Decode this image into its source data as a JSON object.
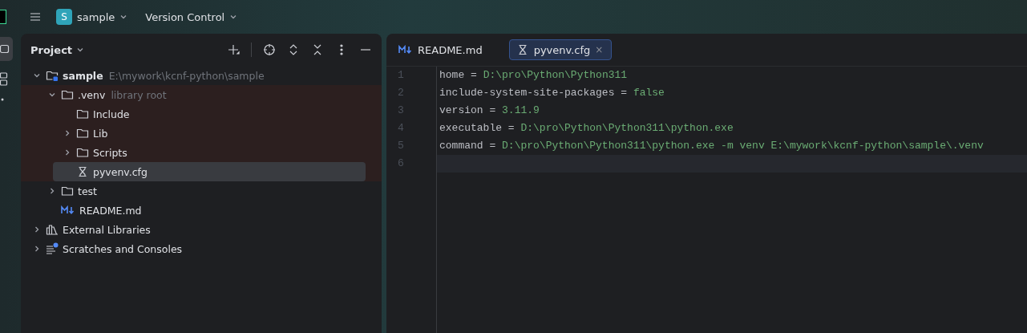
{
  "toolbar": {
    "project_badge": "S",
    "project_name": "sample",
    "vcs": "Version Control"
  },
  "project_panel": {
    "title": "Project",
    "tree": [
      {
        "name": "sample",
        "hint": "E:\\mywork\\kcnf-python\\sample",
        "kind": "module",
        "expanded": true,
        "selected": false,
        "tinted": false,
        "children": [
          {
            "name": ".venv",
            "hint": "library root",
            "kind": "folder",
            "expanded": true,
            "selected": false,
            "tinted": true,
            "children": [
              {
                "name": "Include",
                "kind": "folder",
                "selected": false,
                "tinted": true
              },
              {
                "name": "Lib",
                "kind": "folder",
                "expanded": false,
                "selected": false,
                "tinted": true
              },
              {
                "name": "Scripts",
                "kind": "folder",
                "expanded": false,
                "selected": false,
                "tinted": true
              },
              {
                "name": "pyvenv.cfg",
                "kind": "cfg",
                "selected": true,
                "tinted": true
              }
            ]
          },
          {
            "name": "test",
            "kind": "folder",
            "expanded": false,
            "selected": false,
            "tinted": false
          },
          {
            "name": "README.md",
            "kind": "md",
            "selected": false,
            "tinted": false
          }
        ]
      },
      {
        "name": "External Libraries",
        "kind": "libraries",
        "expanded": false,
        "selected": false,
        "tinted": false
      },
      {
        "name": "Scratches and Consoles",
        "kind": "scratches",
        "expanded": false,
        "selected": false,
        "tinted": false
      }
    ]
  },
  "editor": {
    "tabs": [
      {
        "label": "README.md",
        "kind": "md",
        "selected": false
      },
      {
        "label": "pyvenv.cfg",
        "kind": "cfg",
        "selected": true,
        "close": "×"
      }
    ],
    "lines": [
      {
        "number": "1",
        "key": "home",
        "op": "=",
        "value": "D:\\pro\\Python\\Python311",
        "current": false
      },
      {
        "number": "2",
        "key": "include-system-site-packages",
        "op": "=",
        "value": "false",
        "current": false
      },
      {
        "number": "3",
        "key": "version",
        "op": "=",
        "value": "3.11.9",
        "current": false
      },
      {
        "number": "4",
        "key": "executable",
        "op": "=",
        "value": "D:\\pro\\Python\\Python311\\python.exe",
        "current": false
      },
      {
        "number": "5",
        "key": "command",
        "op": "=",
        "value": "D:\\pro\\Python\\Python311\\python.exe -m venv E:\\mywork\\kcnf-python\\sample\\.venv",
        "current": false
      },
      {
        "number": "6",
        "current": true
      }
    ]
  }
}
